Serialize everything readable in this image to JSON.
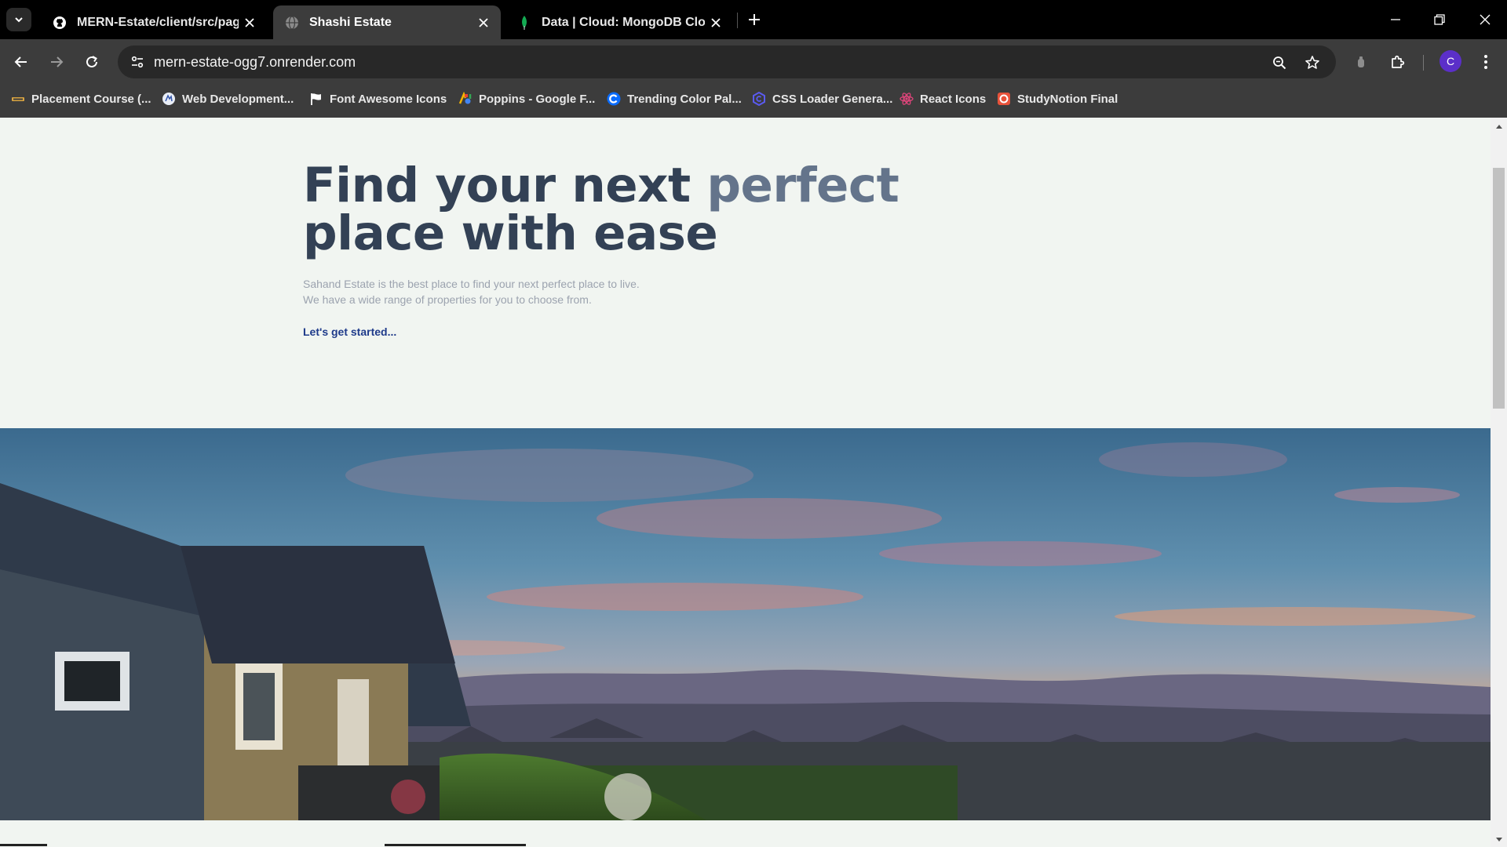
{
  "browser": {
    "tabs": [
      {
        "title": "MERN-Estate/client/src/pages/",
        "favicon": "github-icon",
        "active": false
      },
      {
        "title": "Shashi Estate",
        "favicon": "globe-icon",
        "active": true
      },
      {
        "title": "Data | Cloud: MongoDB Cloud",
        "favicon": "mongodb-leaf-icon",
        "active": false
      }
    ],
    "url": "mern-estate-ogg7.onrender.com",
    "profile_initial": "C",
    "bookmarks": [
      {
        "label": "Placement Course (...",
        "icon": "placement-icon"
      },
      {
        "label": "Web Development...",
        "icon": "webdev-icon"
      },
      {
        "label": "Font Awesome Icons",
        "icon": "flag-icon"
      },
      {
        "label": "Poppins - Google F...",
        "icon": "google-fonts-icon"
      },
      {
        "label": "Trending Color Pal...",
        "icon": "coolors-icon"
      },
      {
        "label": "CSS Loader Genera...",
        "icon": "css-loader-icon"
      },
      {
        "label": "React Icons",
        "icon": "react-icon"
      },
      {
        "label": "StudyNotion Final",
        "icon": "studynotion-icon"
      }
    ]
  },
  "hero": {
    "title_part1": "Find your next ",
    "title_accent": "perfect",
    "title_part2": "place with ease",
    "desc_line1": "Sahand Estate is the best place to find your next perfect place to live.",
    "desc_line2": "We have a wide range of properties for you to choose from.",
    "cta": "Let's get started..."
  },
  "colors": {
    "page_bg": "#f1f5f1",
    "title": "#334155",
    "accent": "#64748b",
    "cta": "#1e3a8a",
    "profile": "#5b2fc9"
  }
}
